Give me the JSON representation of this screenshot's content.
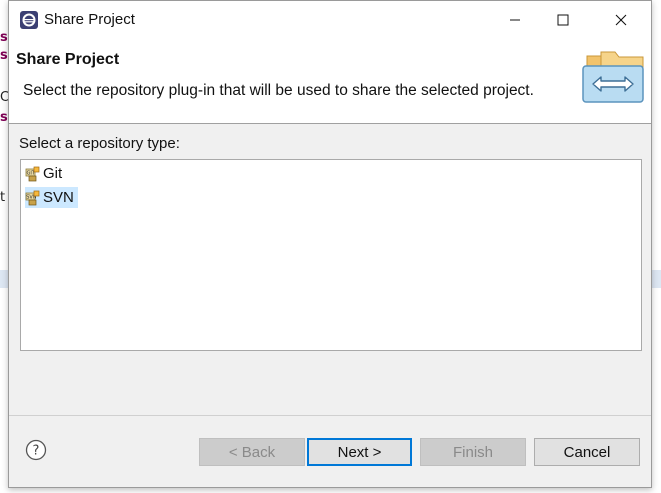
{
  "background": {
    "fragments": [
      "s",
      "s",
      "C",
      "s",
      "t"
    ]
  },
  "window": {
    "title": "Share Project",
    "icons": {
      "app": "eclipse-icon",
      "minimize": "minimize-icon",
      "maximize": "maximize-icon",
      "close": "close-icon"
    }
  },
  "header": {
    "title": "Share Project",
    "description": "Select the repository plug-in that will be used to share the selected project.",
    "image": "share-folders-icon"
  },
  "main": {
    "list_label": "Select a repository type:",
    "items": [
      {
        "label": "Git",
        "icon": "git-repository-icon",
        "selected": false
      },
      {
        "label": "SVN",
        "icon": "svn-repository-icon",
        "selected": true
      }
    ]
  },
  "footer": {
    "help_icon": "help-icon",
    "back_label": "< Back",
    "next_label": "Next >",
    "finish_label": "Finish",
    "cancel_label": "Cancel"
  },
  "colors": {
    "selection": "#cce8ff",
    "default_button_border": "#0078d7",
    "dialog_bg": "#f0f0f0"
  }
}
